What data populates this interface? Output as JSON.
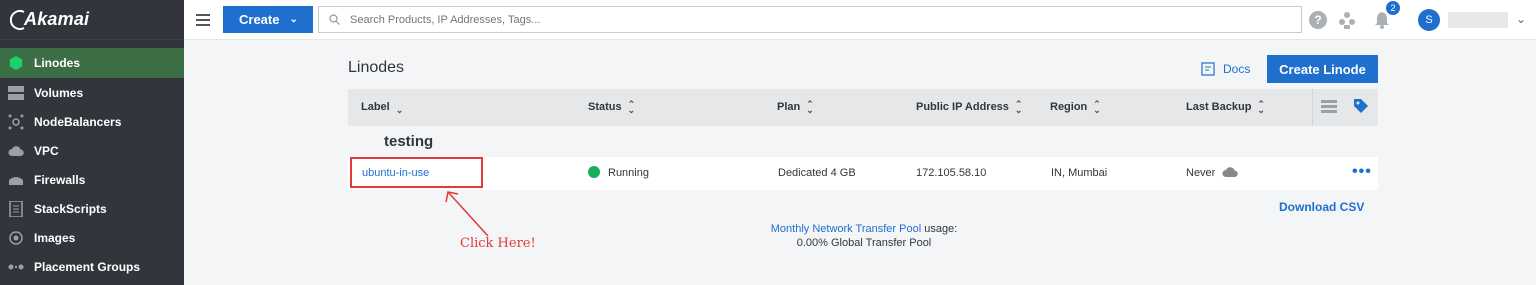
{
  "brand": {
    "name": "Akamai"
  },
  "sidebar": {
    "items": [
      {
        "label": "Linodes",
        "icon": "hexagon-icon",
        "active": true
      },
      {
        "label": "Volumes",
        "icon": "volume-icon"
      },
      {
        "label": "NodeBalancers",
        "icon": "nodebalancer-icon"
      },
      {
        "label": "VPC",
        "icon": "vpc-cloud-icon"
      },
      {
        "label": "Firewalls",
        "icon": "firewall-icon"
      },
      {
        "label": "StackScripts",
        "icon": "script-icon"
      },
      {
        "label": "Images",
        "icon": "image-icon"
      },
      {
        "label": "Placement Groups",
        "icon": "placement-icon"
      }
    ]
  },
  "topbar": {
    "create_label": "Create",
    "search_placeholder": "Search Products, IP Addresses, Tags...",
    "notifications_count": "2",
    "avatar_initial": "S"
  },
  "page": {
    "title": "Linodes",
    "docs_label": "Docs",
    "create_button": "Create Linode"
  },
  "table": {
    "columns": [
      "Label",
      "Status",
      "Plan",
      "Public IP Address",
      "Region",
      "Last Backup"
    ],
    "group": "testing",
    "rows": [
      {
        "label": "ubuntu-in-use",
        "status": "Running",
        "plan": "Dedicated 4 GB",
        "ip": "172.105.58.10",
        "region": "IN, Mumbai",
        "backup": "Never"
      }
    ]
  },
  "footer": {
    "download_csv": "Download CSV",
    "transfer_link": "Monthly Network Transfer Pool",
    "transfer_suffix": "usage:",
    "transfer_value": "0.00% Global Transfer Pool"
  },
  "annotation": {
    "text": "Click Here!"
  },
  "colors": {
    "accent": "#1f6fcf",
    "sidebar": "#32363c",
    "running": "#17b05a",
    "annotation": "#e03a3a"
  }
}
